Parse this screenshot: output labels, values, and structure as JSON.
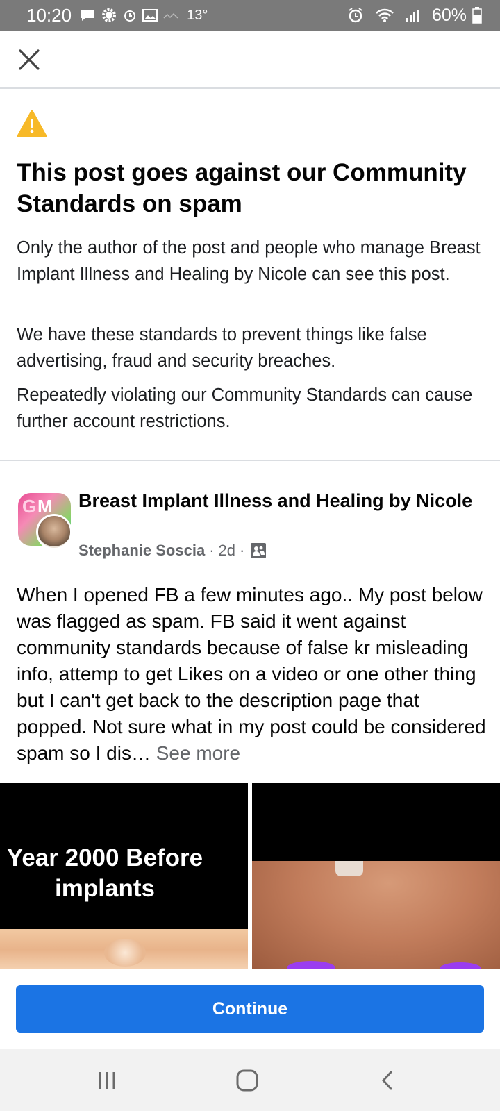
{
  "status_bar": {
    "time": "10:20",
    "temperature": "13°",
    "battery": "60%"
  },
  "notice": {
    "title": "This post goes against our Community Standards on spam",
    "paragraph1": "Only the author of the post and people who manage Breast Implant Illness and Healing by Nicole can see this post.",
    "paragraph2": "We have these standards to prevent things like false advertising, fraud and security breaches.",
    "paragraph3": "Repeatedly violating our Community Standards can cause further account restrictions."
  },
  "post": {
    "group_name": "Breast Implant Illness and Healing by Nicole",
    "author": "Stephanie Soscia",
    "time_ago": "2d",
    "separator": "·",
    "text": "When I opened FB a few minutes ago.. My post below was flagged as spam. FB said it went against community standards because of false kr misleading info, attemp to get Likes on a video or one other thing but I can't get back to the description page that popped. Not sure what in my post could be considered spam so I dis…",
    "see_more": "See more",
    "image_caption": "Year 2000 Before implants"
  },
  "actions": {
    "continue_label": "Continue"
  },
  "colors": {
    "accent": "#1b74e4",
    "warning": "#f7b928",
    "status_bar": "#7a7a7a"
  },
  "icons": [
    "close-icon",
    "warning-icon",
    "audience-members-icon",
    "recent-apps-icon",
    "home-icon",
    "back-icon"
  ]
}
